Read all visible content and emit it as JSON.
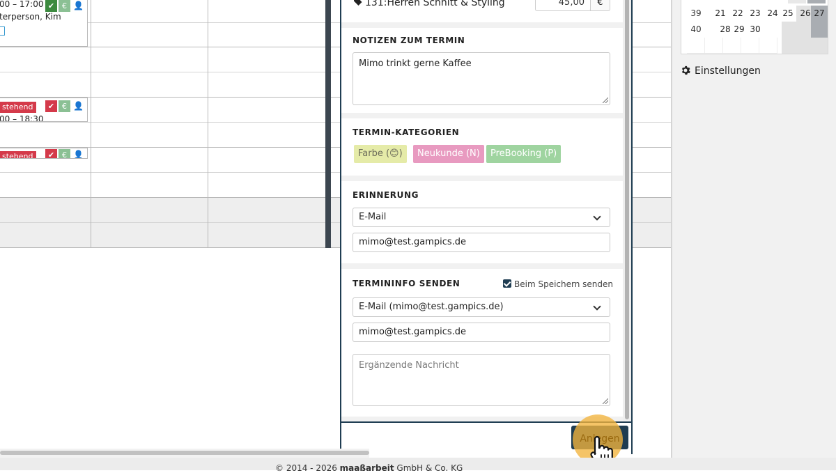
{
  "calendar": {
    "appointments": [
      {
        "time": "00 – 17:00",
        "person": "terperson, Kim",
        "status": ""
      },
      {
        "time": "00 – 18:30",
        "person": "",
        "status": "stehend"
      },
      {
        "time": "",
        "person": "",
        "status": "stehend"
      }
    ],
    "euro_symbol": "€"
  },
  "modal": {
    "service": {
      "code_label": "131:Herren Schnitt & Styling",
      "price": "45,00",
      "currency": "€"
    },
    "notes": {
      "title": "NOTIZEN ZUM TERMIN",
      "value": "Mimo trinkt gerne Kaffee"
    },
    "categories": {
      "title": "TERMIN-KATEGORIEN",
      "items": [
        {
          "label": "Farbe (😊)",
          "color": "#e5eba8"
        },
        {
          "label": "Neukunde (N)",
          "color": "#e89ac0"
        },
        {
          "label": "PreBooking (P)",
          "color": "#9fd4a0"
        }
      ]
    },
    "reminder": {
      "title": "ERINNERUNG",
      "method": "E-Mail",
      "email": "mimo@test.gampics.de"
    },
    "terminfo": {
      "title": "TERMININFO SENDEN",
      "checkbox_label": "Beim Speichern senden",
      "method": "E-Mail (mimo@test.gampics.de)",
      "email": "mimo@test.gampics.de",
      "message_placeholder": "Ergänzende Nachricht"
    },
    "submit_label": "Anlegen"
  },
  "sidebar": {
    "mini_calendar": {
      "rows": [
        {
          "week": "39",
          "days": [
            "",
            "21",
            "22",
            "23",
            "24",
            "25",
            "26",
            "27"
          ]
        },
        {
          "week": "40",
          "days": [
            "",
            "28",
            "29",
            "30",
            "",
            "",
            "",
            ""
          ]
        }
      ]
    },
    "settings_label": "Einstellungen"
  },
  "footer": {
    "prefix": "© 2014 - 2026 ",
    "brand": "maaßarbeit",
    "suffix": " GmbH & Co. KG"
  }
}
